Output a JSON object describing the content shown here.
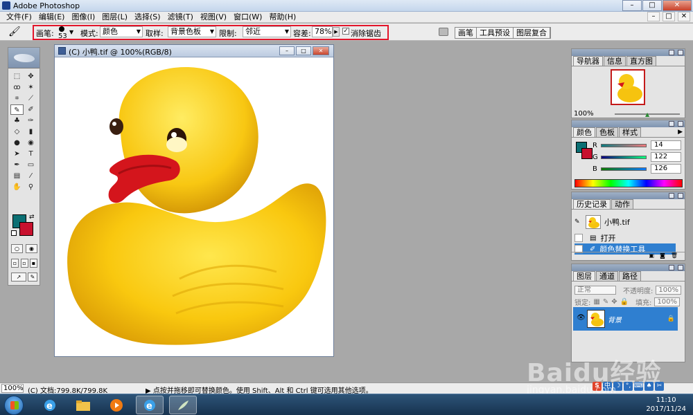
{
  "app": {
    "title": "Adobe Photoshop",
    "window_buttons": [
      "–",
      "□",
      "✕"
    ]
  },
  "menu": {
    "items": [
      "文件(F)",
      "编辑(E)",
      "图像(I)",
      "图层(L)",
      "选择(S)",
      "滤镜(T)",
      "视图(V)",
      "窗口(W)",
      "帮助(H)"
    ]
  },
  "options": {
    "brush_label": "画笔:",
    "brush_size": "53",
    "mode_label": "模式:",
    "mode_value": "颜色",
    "sampling_label": "取样:",
    "sampling_value": "背景色板",
    "limits_label": "限制:",
    "limits_value": "邻近",
    "tolerance_label": "容差:",
    "tolerance_value": "78%",
    "antialias_label": "消除锯齿",
    "antialias_checked": "✓",
    "palette_well": [
      "画笔",
      "工具预设",
      "图层复合"
    ]
  },
  "toolbox": {
    "foreground_color": "#0b6f73",
    "background_color": "#c8102e"
  },
  "document": {
    "title": "(C) 小鸭.tif @ 100%(RGB/8)"
  },
  "navigator": {
    "tabs": [
      "导航器",
      "信息",
      "直方图"
    ],
    "zoom": "100%"
  },
  "color_panel": {
    "tabs": [
      "颜色",
      "色板",
      "样式"
    ],
    "channels": [
      {
        "name": "R",
        "value": "14"
      },
      {
        "name": "G",
        "value": "122"
      },
      {
        "name": "B",
        "value": "126"
      }
    ]
  },
  "history": {
    "tabs": [
      "历史记录",
      "动作"
    ],
    "snapshot": "小鸭.tif",
    "states": [
      "打开",
      "颜色替换工具"
    ]
  },
  "layers": {
    "tabs": [
      "图层",
      "通道",
      "路径"
    ],
    "blend_mode": "正常",
    "opacity_label": "不透明度:",
    "opacity_value": "100%",
    "lock_label": "锁定:",
    "fill_label": "填充:",
    "fill_value": "100%",
    "layer_name": "背景"
  },
  "status": {
    "zoom": "100%",
    "doc_info": "(C) 文档:799.8K/799.8K",
    "tip": "▶  点按并拖移即可替换颜色。使用 Shift、Alt 和 Ctrl 键可选用其他选项。"
  },
  "taskbar": {
    "time": "11:10",
    "date": "2017/11/24",
    "ime": [
      "S",
      "中"
    ]
  },
  "watermark": {
    "logo": "Baidu经验",
    "url": "jingyan.baidu.com"
  }
}
